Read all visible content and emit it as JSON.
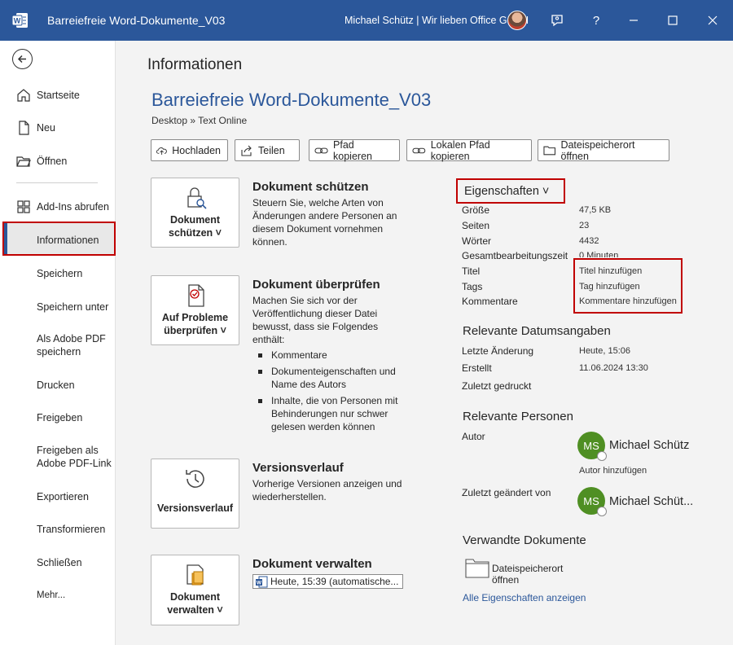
{
  "titlebar": {
    "app_icon": "word-icon",
    "title": "Barreiefreie Word-Dokumente_V03",
    "user": "Michael Schütz  |  Wir lieben Office GmbH",
    "buttons": [
      "feedback-icon",
      "help-icon",
      "minimize-icon",
      "maximize-icon",
      "close-icon"
    ],
    "help_label": "?",
    "color": "#2b579a"
  },
  "sidebar": {
    "back_icon": "back-arrow-icon",
    "items": [
      {
        "label": "Startseite",
        "icon": "home-icon"
      },
      {
        "label": "Neu",
        "icon": "new-document-icon"
      },
      {
        "label": "Öffnen",
        "icon": "folder-open-icon"
      },
      {
        "label": "Add-Ins abrufen",
        "icon": "addins-icon"
      },
      {
        "label": "Informationen",
        "active": true
      },
      {
        "label": "Speichern"
      },
      {
        "label": "Speichern unter"
      },
      {
        "label": "Als Adobe PDF speichern"
      },
      {
        "label": "Drucken"
      },
      {
        "label": "Freigeben"
      },
      {
        "label": "Freigeben als Adobe PDF-Link"
      },
      {
        "label": "Exportieren"
      },
      {
        "label": "Transformieren"
      },
      {
        "label": "Schließen"
      },
      {
        "label": "Mehr..."
      }
    ]
  },
  "main": {
    "page_title": "Informationen",
    "doc_title": "Barreiefreie Word-Dokumente_V03",
    "doc_path": "Desktop » Text Online",
    "actions": [
      {
        "label": "Hochladen",
        "icon": "upload-cloud-icon"
      },
      {
        "label": "Teilen",
        "icon": "share-icon"
      },
      {
        "label": "Pfad kopieren",
        "icon": "link-icon"
      },
      {
        "label": "Lokalen Pfad kopieren",
        "icon": "link-icon"
      },
      {
        "label": "Dateispeicherort öffnen",
        "icon": "folder-icon"
      }
    ],
    "sections": {
      "protect": {
        "button": "Dokument schützen ˅",
        "button_l1": "Dokument",
        "button_l2": "schützen ˅",
        "title": "Dokument schützen",
        "text": "Steuern Sie, welche Arten von Änderungen andere Personen an diesem Dokument vornehmen können."
      },
      "inspect": {
        "button_l1": "Auf Probleme",
        "button_l2": "überprüfen ˅",
        "title": "Dokument überprüfen",
        "text": "Machen Sie sich vor der Veröffentlichung dieser Datei bewusst, dass sie Folgendes enthält:",
        "bullets": [
          "Kommentare",
          "Dokumenteigenschaften und Name des Autors",
          "Inhalte, die von Personen mit Behinderungen nur schwer gelesen werden können"
        ]
      },
      "versions": {
        "button": "Versionsverlauf",
        "title": "Versionsverlauf",
        "text": "Vorherige Versionen anzeigen und wiederherstellen."
      },
      "manage": {
        "button_l1": "Dokument",
        "button_l2": "verwalten ˅",
        "title": "Dokument verwalten",
        "version_entry": "Heute, 15:39 (automatische..."
      }
    }
  },
  "properties": {
    "header": "Eigenschaften ˅",
    "rows": [
      {
        "label": "Größe",
        "value": "47,5 KB"
      },
      {
        "label": "Seiten",
        "value": "23"
      },
      {
        "label": "Wörter",
        "value": "4432"
      },
      {
        "label": "Gesamtbearbeitungszeit",
        "value": "0 Minuten"
      },
      {
        "label": "Titel",
        "value": "Titel hinzufügen"
      },
      {
        "label": "Tags",
        "value": "Tag hinzufügen"
      },
      {
        "label": "Kommentare",
        "value": "Kommentare hinzufügen"
      }
    ],
    "dates_title": "Relevante Datumsangaben",
    "dates": [
      {
        "label": "Letzte Änderung",
        "value": "Heute, 15:06"
      },
      {
        "label": "Erstellt",
        "value": "11.06.2024 13:30"
      },
      {
        "label": "Zuletzt gedruckt",
        "value": ""
      }
    ],
    "people_title": "Relevante Personen",
    "author_label": "Autor",
    "author_initials": "MS",
    "author_name": "Michael Schütz",
    "add_author": "Autor hinzufügen",
    "modified_label": "Zuletzt geändert von",
    "modified_initials": "MS",
    "modified_name": "Michael Schüt...",
    "related_title": "Verwandte Dokumente",
    "open_location": "Dateispeicherort öffnen",
    "all_props": "Alle Eigenschaften anzeigen",
    "highlight_color": "#c00000",
    "avatar_color": "#4f8f23"
  }
}
